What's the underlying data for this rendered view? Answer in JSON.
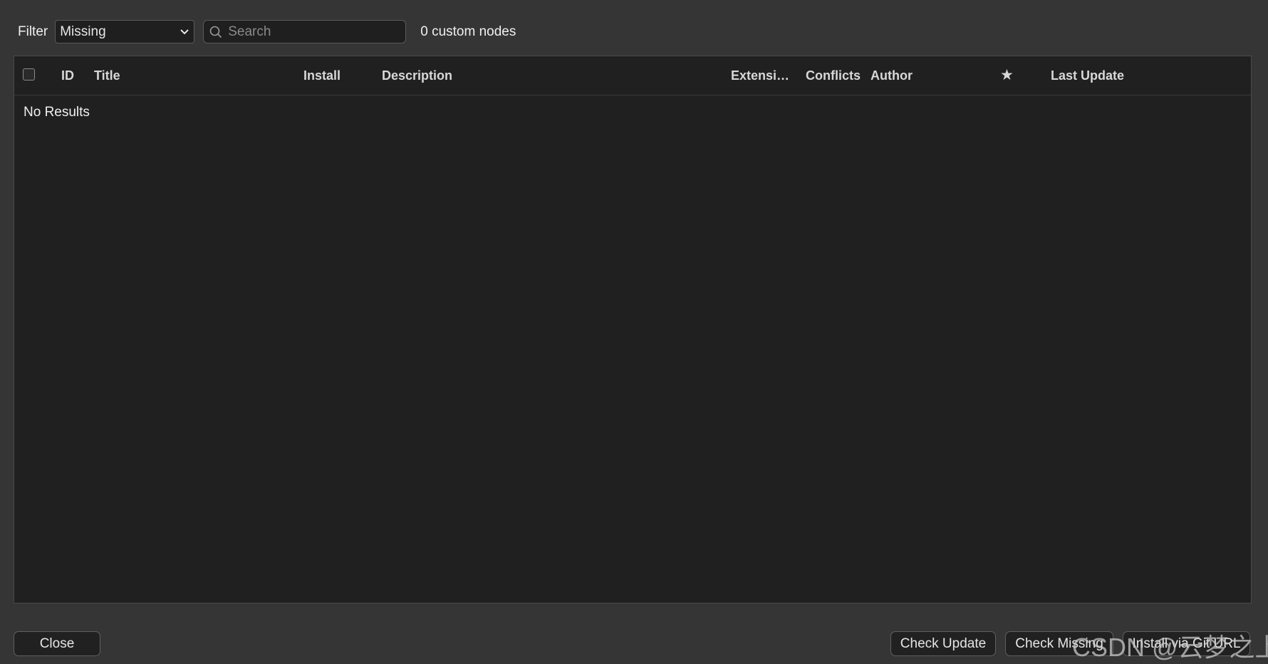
{
  "toolbar": {
    "filter_label": "Filter",
    "filter_value": "Missing",
    "search_placeholder": "Search",
    "search_value": "",
    "node_count": "0 custom nodes"
  },
  "table": {
    "columns": {
      "id": "ID",
      "title": "Title",
      "install": "Install",
      "description": "Description",
      "extension": "Extensi…",
      "conflicts": "Conflicts",
      "author": "Author",
      "stars": "★",
      "last_update": "Last Update"
    },
    "empty_message": "No Results",
    "rows": []
  },
  "footer": {
    "close_label": "Close",
    "check_update_label": "Check Update",
    "check_missing_label": "Check Missing",
    "install_url_label": "Install via Git URL"
  },
  "watermark": "CSDN @云梦之上"
}
